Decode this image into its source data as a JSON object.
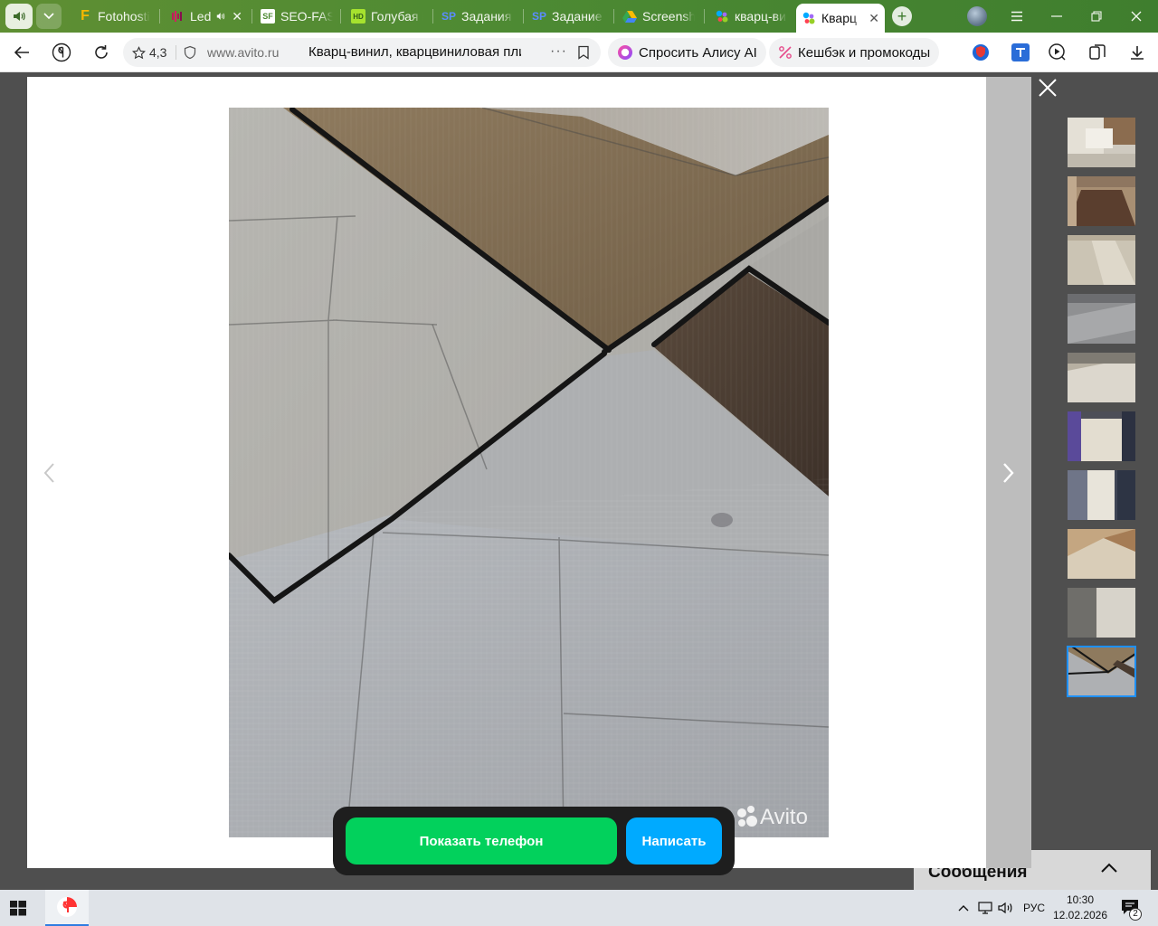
{
  "browser": {
    "tabs": [
      {
        "label": "Fotohosting",
        "favicon": "F",
        "favicon_color": "#f6b800"
      },
      {
        "label": "Led",
        "favicon": "bars",
        "favicon_color": "#c2185b",
        "audio": true
      },
      {
        "label": "SEO-FAST",
        "favicon": "SF",
        "favicon_color": "#ffffff"
      },
      {
        "label": "Голубая Е",
        "favicon": "HD",
        "favicon_color": "#a6e22e"
      },
      {
        "label": "Задания",
        "favicon": "SP",
        "favicon_color": "#2b6cff"
      },
      {
        "label": "Задание",
        "favicon": "SP",
        "favicon_color": "#2b6cff"
      },
      {
        "label": "Screenshot",
        "favicon": "drive",
        "favicon_color": "#fbbc04"
      },
      {
        "label": "кварц-ви",
        "favicon": "dots",
        "favicon_color": "#00aaff"
      },
      {
        "label": "Кварц",
        "favicon": "dots",
        "favicon_color": "#00aaff",
        "active": true
      }
    ],
    "new_tab": "+",
    "address": {
      "rating": "4,3",
      "domain": "www.avito.ru",
      "page_title": "Кварц-винил, кварцвиниловая плитка",
      "more": "···"
    },
    "alice_label": "Спросить Алису AI",
    "cashback_label": "Кешбэк и промокоды"
  },
  "viewer": {
    "watermark": "Avito",
    "thumbnails_count": 10,
    "selected_thumbnail": 10,
    "show_phone_label": "Показать телефон",
    "write_label": "Написать",
    "messages_label": "Сообщения"
  },
  "taskbar": {
    "language": "РУС",
    "time": "10:30",
    "date": "12.02.2026",
    "notifications": "2"
  },
  "colors": {
    "tab_strip": "#4d8a33",
    "phone_button": "#02d15c",
    "write_button": "#00aaff",
    "selected_thumb_outline": "#1e90ff"
  }
}
